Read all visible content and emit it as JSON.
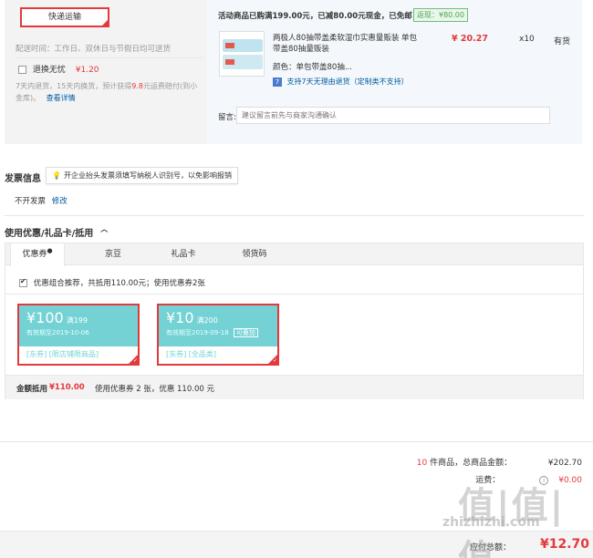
{
  "shipping": {
    "button_label": "快递运输",
    "delivery_time": "配送时间：工作日、双休日与节假日均可送货",
    "return_label": "退换无忧",
    "return_price": "¥1.20",
    "return_desc_1": "7天内退货，15天内换货，预计获得",
    "return_desc_highlight": "9.8",
    "return_desc_2": "元运费赔付(到小金库)。",
    "return_link": "查看详情"
  },
  "promo": {
    "text": "活动商品已购满199.00元，已减80.00元现金，已免邮",
    "badge": "返现：¥80.00"
  },
  "product": {
    "name": "两极人80抽带盖柔软湿巾实惠量贩装 单包带盖80抽量贩装",
    "price": "¥ 20.27",
    "qty": "x10",
    "stock": "有货",
    "color": "颜色：单包带盖80抽...",
    "return_policy": "支持7天无理由退货（定制类不支持）",
    "return_icon_label": "7"
  },
  "message": {
    "label": "留言:",
    "placeholder": "建议留言前先与商家沟通确认"
  },
  "invoice": {
    "title": "发票信息",
    "tip": "开企业抬头发票须填写纳税人识别号，以免影响报销",
    "value": "不开发票",
    "edit": "修改"
  },
  "coupons": {
    "title": "使用优惠/礼品卡/抵用",
    "arrow": "^",
    "tabs": [
      "优惠券",
      "京豆",
      "礼品卡",
      "领货码"
    ],
    "combo_text": "优惠组合推荐，共抵用110.00元；使用优惠券2张",
    "items": [
      {
        "amount": "¥100",
        "cond": "满199",
        "valid": "有效期至2019-10-06",
        "tags": "[东券] [限店铺限商品]",
        "stack": ""
      },
      {
        "amount": "¥10",
        "cond": "满200",
        "valid": "有效期至2019-09-18",
        "tags": "[东券] [全品类]",
        "stack": "可叠加"
      }
    ],
    "summary_label": "金额抵用",
    "summary_amount": "¥110.00",
    "summary_desc": "使用优惠券 2 张，优惠 110.00 元"
  },
  "totals": {
    "count_num": "10",
    "count_text": "件商品，总商品金额：",
    "goods_amount": "¥202.70",
    "shipping_label": "运费：",
    "shipping_amount": "¥0.00",
    "payable_label": "应付总额：",
    "payable_amount": "¥12.70"
  },
  "watermark": {
    "big": "值|值|值",
    "small": "zhizhizhi.com"
  },
  "colors": {
    "accent": "#e4393c",
    "coupon_bg": "#74d2d4",
    "link": "#005aa0"
  }
}
